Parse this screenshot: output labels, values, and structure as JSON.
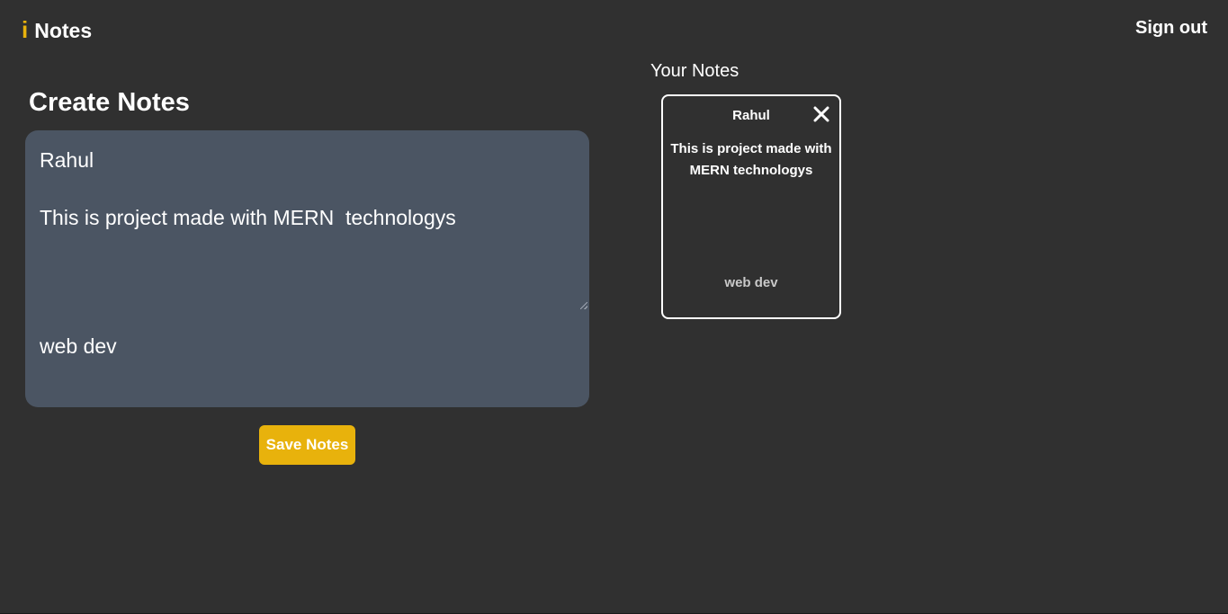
{
  "header": {
    "logo_letter": "i",
    "app_name": "Notes",
    "signout_label": "Sign out"
  },
  "create": {
    "heading": "Create Notes",
    "title_value": "Rahul",
    "description_value": "This is project made with MERN  technologys",
    "tag_value": "web dev",
    "save_label": "Save Notes"
  },
  "notes": {
    "heading": "Your Notes",
    "items": [
      {
        "title": "Rahul",
        "description": "This is project made with MERN technologys",
        "tag": "web dev"
      }
    ]
  },
  "icons": {
    "logo": "info-i-icon",
    "delete": "close-icon"
  },
  "colors": {
    "background": "#303030",
    "accent": "#e8b20c",
    "editor_background": "#4b5563",
    "text": "#ffffff",
    "tag_text": "#c9c9c9"
  }
}
